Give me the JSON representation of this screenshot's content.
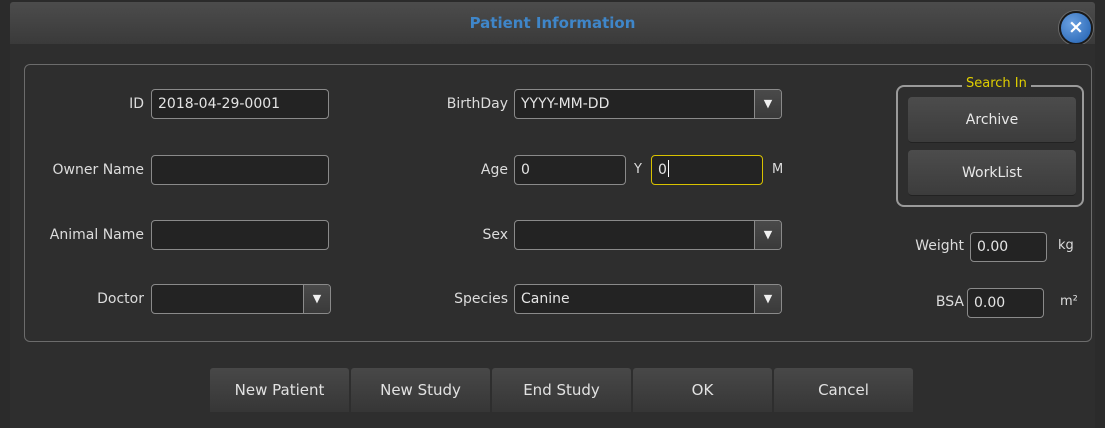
{
  "window": {
    "title": "Patient Information",
    "close_icon": "×"
  },
  "fields": {
    "id": {
      "label": "ID",
      "value": "2018-04-29-0001"
    },
    "owner_name": {
      "label": "Owner Name",
      "value": ""
    },
    "animal_name": {
      "label": "Animal Name",
      "value": ""
    },
    "doctor": {
      "label": "Doctor",
      "value": ""
    },
    "birthday": {
      "label": "BirthDay",
      "value": "YYYY-MM-DD"
    },
    "age": {
      "label": "Age",
      "years_value": "0",
      "years_unit": "Y",
      "months_value": "0",
      "months_unit": "M"
    },
    "sex": {
      "label": "Sex",
      "value": ""
    },
    "species": {
      "label": "Species",
      "value": "Canine"
    },
    "weight": {
      "label": "Weight",
      "value": "0.00",
      "unit": "kg"
    },
    "bsa": {
      "label": "BSA",
      "value": "0.00",
      "unit": "m²"
    }
  },
  "search_in": {
    "title": "Search In",
    "archive_label": "Archive",
    "worklist_label": "WorkList"
  },
  "dropdown_arrow": "▼",
  "buttons": {
    "new_patient": "New Patient",
    "new_study": "New Study",
    "end_study": "End Study",
    "ok": "OK",
    "cancel": "Cancel"
  },
  "colors": {
    "title": "#3f86c9",
    "accent_focus": "#d8c200",
    "background": "#2b2b2b"
  }
}
